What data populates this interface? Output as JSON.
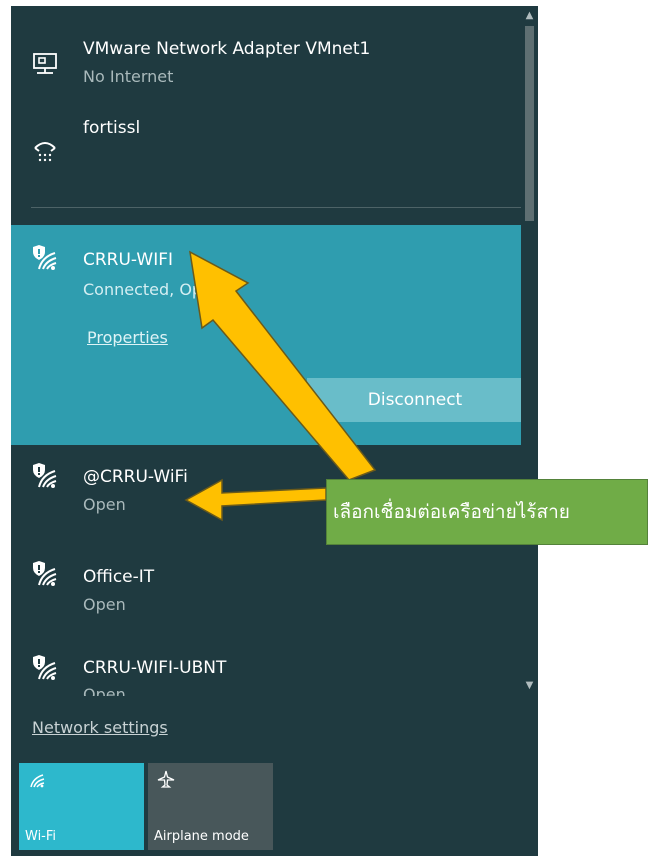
{
  "panel": {
    "networks_top": [
      {
        "name": "VMware Network Adapter VMnet1",
        "status": "No Internet",
        "icon": "ethernet-icon"
      },
      {
        "name": "fortissl",
        "status": "",
        "icon": "dialup-icon"
      }
    ],
    "selected": {
      "name": "CRRU-WIFI",
      "status": "Connected, Open",
      "icon": "wifi-secured-icon",
      "properties_label": "Properties",
      "disconnect_label": "Disconnect"
    },
    "networks_bottom": [
      {
        "name": "@CRRU-WiFi",
        "status": "Open",
        "icon": "wifi-secured-icon"
      },
      {
        "name": "Office-IT",
        "status": "Open",
        "icon": "wifi-secured-icon"
      },
      {
        "name": "CRRU-WIFI-UBNT",
        "status": "Open",
        "icon": "wifi-secured-icon"
      }
    ],
    "network_settings_label": "Network settings",
    "tiles": [
      {
        "label": "Wi-Fi",
        "icon": "wifi-icon",
        "active": true
      },
      {
        "label": "Airplane mode",
        "icon": "airplane-icon",
        "active": false
      }
    ]
  },
  "annotation": {
    "text": "เลือกเชื่อมต่อเครือข่ายไร้สาย"
  },
  "colors": {
    "panel_bg": "#1f3a40",
    "selected_bg": "#2f9daf",
    "wifi_tile": "#2db8cc",
    "airplane_tile": "#48575a",
    "annotation_bg": "#70ac47",
    "arrow": "#ffc000"
  }
}
